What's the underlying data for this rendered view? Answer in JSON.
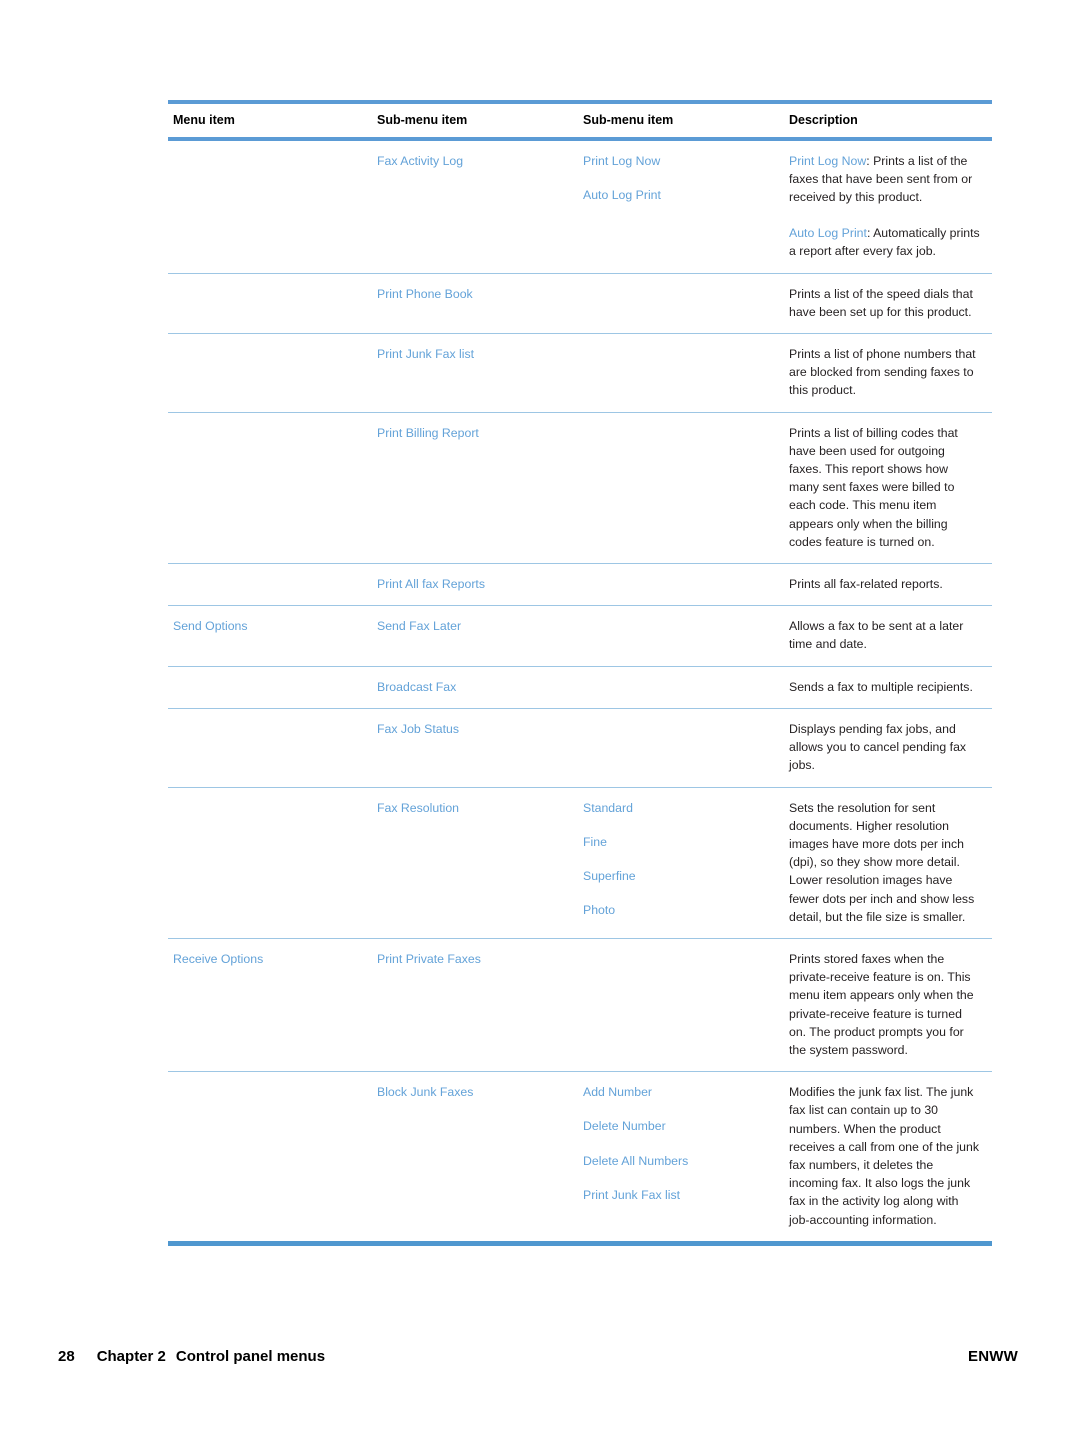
{
  "table": {
    "headers": [
      "Menu item",
      "Sub-menu item",
      "Sub-menu item",
      "Description"
    ],
    "rows": [
      {
        "menu": [],
        "sub1": [
          "Fax Activity Log"
        ],
        "sub2": [
          "Print Log Now",
          "Auto Log Print"
        ],
        "desc": [
          {
            "emph": "Print Log Now",
            "sep": ": ",
            "text": "Prints a list of the faxes that have been sent from or received by this product."
          },
          {
            "emph": "Auto Log Print",
            "sep": ": ",
            "text": "Automatically prints a report after every fax job."
          }
        ]
      },
      {
        "menu": [],
        "sub1": [
          "Print Phone Book"
        ],
        "sub2": [],
        "desc": [
          {
            "emph": "",
            "sep": "",
            "text": "Prints a list of the speed dials that have been set up for this product."
          }
        ]
      },
      {
        "menu": [],
        "sub1": [
          "Print Junk Fax list"
        ],
        "sub2": [],
        "desc": [
          {
            "emph": "",
            "sep": "",
            "text": "Prints a list of phone numbers that are blocked from sending faxes to this product."
          }
        ]
      },
      {
        "menu": [],
        "sub1": [
          "Print Billing Report"
        ],
        "sub2": [],
        "desc": [
          {
            "emph": "",
            "sep": "",
            "text": "Prints a list of billing codes that have been used for outgoing faxes. This report shows how many sent faxes were billed to each code. This menu item appears only when the billing codes feature is turned on."
          }
        ]
      },
      {
        "menu": [],
        "sub1": [
          "Print All fax Reports"
        ],
        "sub2": [],
        "desc": [
          {
            "emph": "",
            "sep": "",
            "text": "Prints all fax-related reports."
          }
        ]
      },
      {
        "menu": [
          "Send Options"
        ],
        "sub1": [
          "Send Fax Later"
        ],
        "sub2": [],
        "desc": [
          {
            "emph": "",
            "sep": "",
            "text": "Allows a fax to be sent at a later time and date."
          }
        ]
      },
      {
        "menu": [],
        "sub1": [
          "Broadcast Fax"
        ],
        "sub2": [],
        "desc": [
          {
            "emph": "",
            "sep": "",
            "text": "Sends a fax to multiple recipients."
          }
        ]
      },
      {
        "menu": [],
        "sub1": [
          "Fax Job Status"
        ],
        "sub2": [],
        "desc": [
          {
            "emph": "",
            "sep": "",
            "text": "Displays pending fax jobs, and allows you to cancel pending fax jobs."
          }
        ]
      },
      {
        "menu": [],
        "sub1": [
          "Fax Resolution"
        ],
        "sub2": [
          "Standard",
          "Fine",
          "Superfine",
          "Photo"
        ],
        "desc": [
          {
            "emph": "",
            "sep": "",
            "text": "Sets the resolution for sent documents. Higher resolution images have more dots per inch (dpi), so they show more detail. Lower resolution images have fewer dots per inch and show less detail, but the file size is smaller."
          }
        ]
      },
      {
        "menu": [
          "Receive Options"
        ],
        "sub1": [
          "Print Private Faxes"
        ],
        "sub2": [],
        "desc": [
          {
            "emph": "",
            "sep": "",
            "text": "Prints stored faxes when the private-receive feature is on. This menu item appears only when the private-receive feature is turned on. The product prompts you for the system password."
          }
        ]
      },
      {
        "menu": [],
        "sub1": [
          "Block Junk Faxes"
        ],
        "sub2": [
          "Add Number",
          "Delete Number",
          "Delete All Numbers",
          "Print Junk Fax list"
        ],
        "desc": [
          {
            "emph": "",
            "sep": "",
            "text": "Modifies the junk fax list. The junk fax list can contain up to 30 numbers. When the product receives a call from one of the junk fax numbers, it deletes the incoming fax. It also logs the junk fax in the activity log along with job-accounting information."
          }
        ]
      }
    ]
  },
  "footer": {
    "page_number": "28",
    "chapter_label": "Chapter 2",
    "chapter_title": "Control panel menus",
    "edition": "ENWW"
  },
  "colors": {
    "link_blue": "#63a2d8",
    "rule_blue": "#5b9bd5",
    "divider_blue": "#9dc6e4",
    "body_text": "#231f20"
  }
}
